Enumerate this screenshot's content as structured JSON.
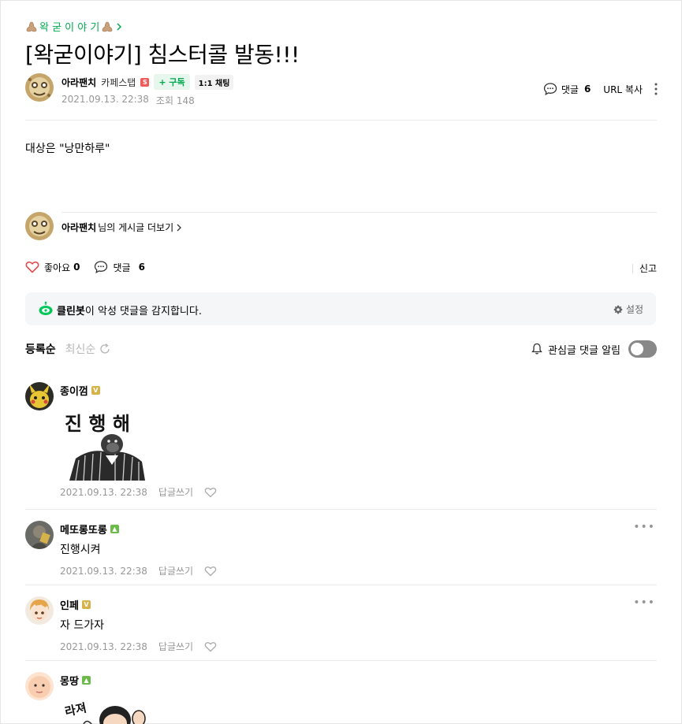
{
  "post": {
    "board": "왁 굳 이 야 기",
    "title": "[왁굳이야기] 침스터콜 발동!!!",
    "author": "아라팬치",
    "grade": "카페스탭",
    "subscribe_label": "+ 구독",
    "chat_label": "1:1 채팅",
    "date": "2021.09.13. 22:38",
    "views": "조회 148",
    "comments_label": "댓글",
    "comments_count": "6",
    "url_copy": "URL 복사",
    "body": "대상은 \"낭만하루\"",
    "more_posts_author": "아라팬치",
    "more_posts_suffix": "님의 게시글 더보기"
  },
  "actions": {
    "like_label": "좋아요",
    "like_count": "0",
    "comment_label": "댓글",
    "comment_count": "6",
    "report": "신고"
  },
  "cleanbot": {
    "name": "클린봇",
    "text": "이 악성 댓글을 감지합니다.",
    "setting": "설정"
  },
  "comment_toolbar": {
    "sort_registered": "등록순",
    "sort_latest": "최신순",
    "notify_label": "관심글 댓글 알림"
  },
  "comments": [
    {
      "nick": "종이껌",
      "level": "V",
      "sticker_text": "진 행 해",
      "date": "2021.09.13. 22:38",
      "reply": "답글쓰기"
    },
    {
      "nick": "메또롱또롱",
      "level": "▲",
      "text": "진행시켜",
      "date": "2021.09.13. 22:38",
      "reply": "답글쓰기"
    },
    {
      "nick": "인페",
      "level": "V",
      "text": "자 드가자",
      "date": "2021.09.13. 22:38",
      "reply": "답글쓰기"
    },
    {
      "nick": "몽땅",
      "level": "▲",
      "sticker_text": "라져"
    }
  ],
  "colors": {
    "accent_green": "#03a94f",
    "like_red": "#e24b4b",
    "muted": "#979797"
  }
}
